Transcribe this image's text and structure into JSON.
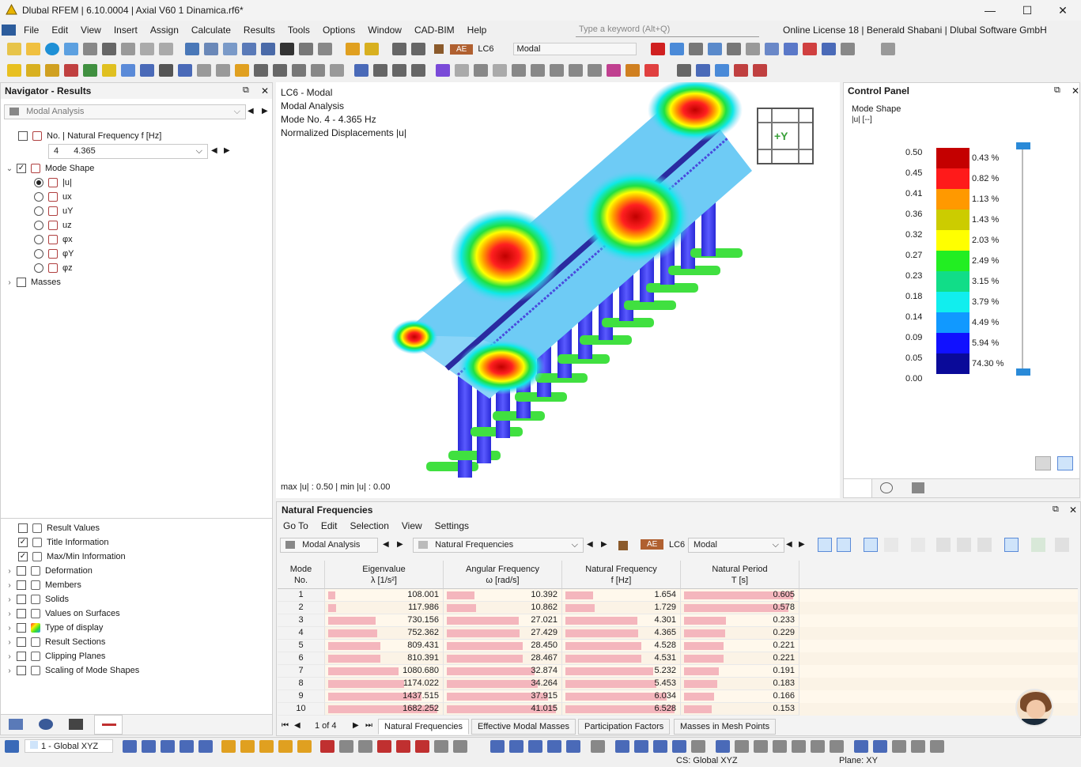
{
  "window": {
    "title": "Dlubal RFEM | 6.10.0004 | Axial V60 1 Dinamica.rf6*",
    "minimize": "—",
    "maximize": "☐",
    "close": "✕"
  },
  "menu": [
    "File",
    "Edit",
    "View",
    "Insert",
    "Assign",
    "Calculate",
    "Results",
    "Tools",
    "Options",
    "Window",
    "CAD-BIM",
    "Help"
  ],
  "search": {
    "placeholder": "Type a keyword (Alt+Q)"
  },
  "license": "Online License 18 | Benerald Shabani | Dlubal Software GmbH",
  "toolbar": {
    "ae": "AE",
    "lc": "LC6",
    "lc_name": "Modal"
  },
  "navigator": {
    "title": "Navigator - Results",
    "combo": "Modal Analysis",
    "freq_label": "No. | Natural Frequency f [Hz]",
    "mode_no": "4",
    "mode_freq": "4.365",
    "mode_shape_label": "Mode Shape",
    "shape_options": [
      "|u|",
      "ux",
      "uY",
      "uz",
      "φx",
      "φY",
      "φz"
    ],
    "masses": "Masses",
    "display_items": [
      "Result Values",
      "Title Information",
      "Max/Min Information",
      "Deformation",
      "Members",
      "Solids",
      "Values on Surfaces",
      "Type of display",
      "Result Sections",
      "Clipping Planes",
      "Scaling of Mode Shapes"
    ]
  },
  "viewport": {
    "lines": [
      "LC6 - Modal",
      "Modal Analysis",
      "Mode No. 4 - 4.365 Hz",
      "Normalized Displacements |u|"
    ],
    "maxmin": "max |u| : 0.50 | min |u| : 0.00",
    "view_cube": "+Y"
  },
  "control_panel": {
    "title": "Control Panel",
    "heading": "Mode Shape",
    "unit": "|u| [--]",
    "values": [
      "0.50",
      "0.45",
      "0.41",
      "0.36",
      "0.32",
      "0.27",
      "0.23",
      "0.18",
      "0.14",
      "0.09",
      "0.05",
      "0.00"
    ],
    "percents": [
      "0.43 %",
      "0.82 %",
      "1.13 %",
      "1.43 %",
      "2.03 %",
      "2.49 %",
      "3.15 %",
      "3.79 %",
      "4.49 %",
      "5.94 %",
      "74.30 %"
    ],
    "colors": [
      "#c40000",
      "#ff1a1a",
      "#ff9900",
      "#cccc00",
      "#ffff00",
      "#22ee22",
      "#11dd88",
      "#11eeee",
      "#1199ff",
      "#1111ff",
      "#0a0a99"
    ]
  },
  "results": {
    "title": "Natural Frequencies",
    "menu": [
      "Go To",
      "Edit",
      "Selection",
      "View",
      "Settings"
    ],
    "combo_analysis": "Modal Analysis",
    "combo_table": "Natural Frequencies",
    "ae": "AE",
    "lc": "LC6",
    "lc_name": "Modal",
    "headers": [
      {
        "top": "Mode",
        "bottom": "No."
      },
      {
        "top": "Eigenvalue",
        "bottom": "λ [1/s²]"
      },
      {
        "top": "Angular Frequency",
        "bottom": "ω [rad/s]"
      },
      {
        "top": "Natural Frequency",
        "bottom": "f [Hz]"
      },
      {
        "top": "Natural Period",
        "bottom": "T [s]"
      }
    ],
    "rows": [
      [
        "1",
        "108.001",
        "10.392",
        "1.654",
        "0.605"
      ],
      [
        "2",
        "117.986",
        "10.862",
        "1.729",
        "0.578"
      ],
      [
        "3",
        "730.156",
        "27.021",
        "4.301",
        "0.233"
      ],
      [
        "4",
        "752.362",
        "27.429",
        "4.365",
        "0.229"
      ],
      [
        "5",
        "809.431",
        "28.450",
        "4.528",
        "0.221"
      ],
      [
        "6",
        "810.391",
        "28.467",
        "4.531",
        "0.221"
      ],
      [
        "7",
        "1080.680",
        "32.874",
        "5.232",
        "0.191"
      ],
      [
        "8",
        "1174.022",
        "34.264",
        "5.453",
        "0.183"
      ],
      [
        "9",
        "1437.515",
        "37.915",
        "6.034",
        "0.166"
      ],
      [
        "10",
        "1682.252",
        "41.015",
        "6.528",
        "0.153"
      ]
    ],
    "pager": "1 of 4",
    "tabs": [
      "Natural Frequencies",
      "Effective Modal Masses",
      "Participation Factors",
      "Masses in Mesh Points"
    ]
  },
  "bottom": {
    "cs_combo": "1 - Global XYZ"
  },
  "status": {
    "cs": "CS: Global XYZ",
    "plane": "Plane: XY"
  }
}
